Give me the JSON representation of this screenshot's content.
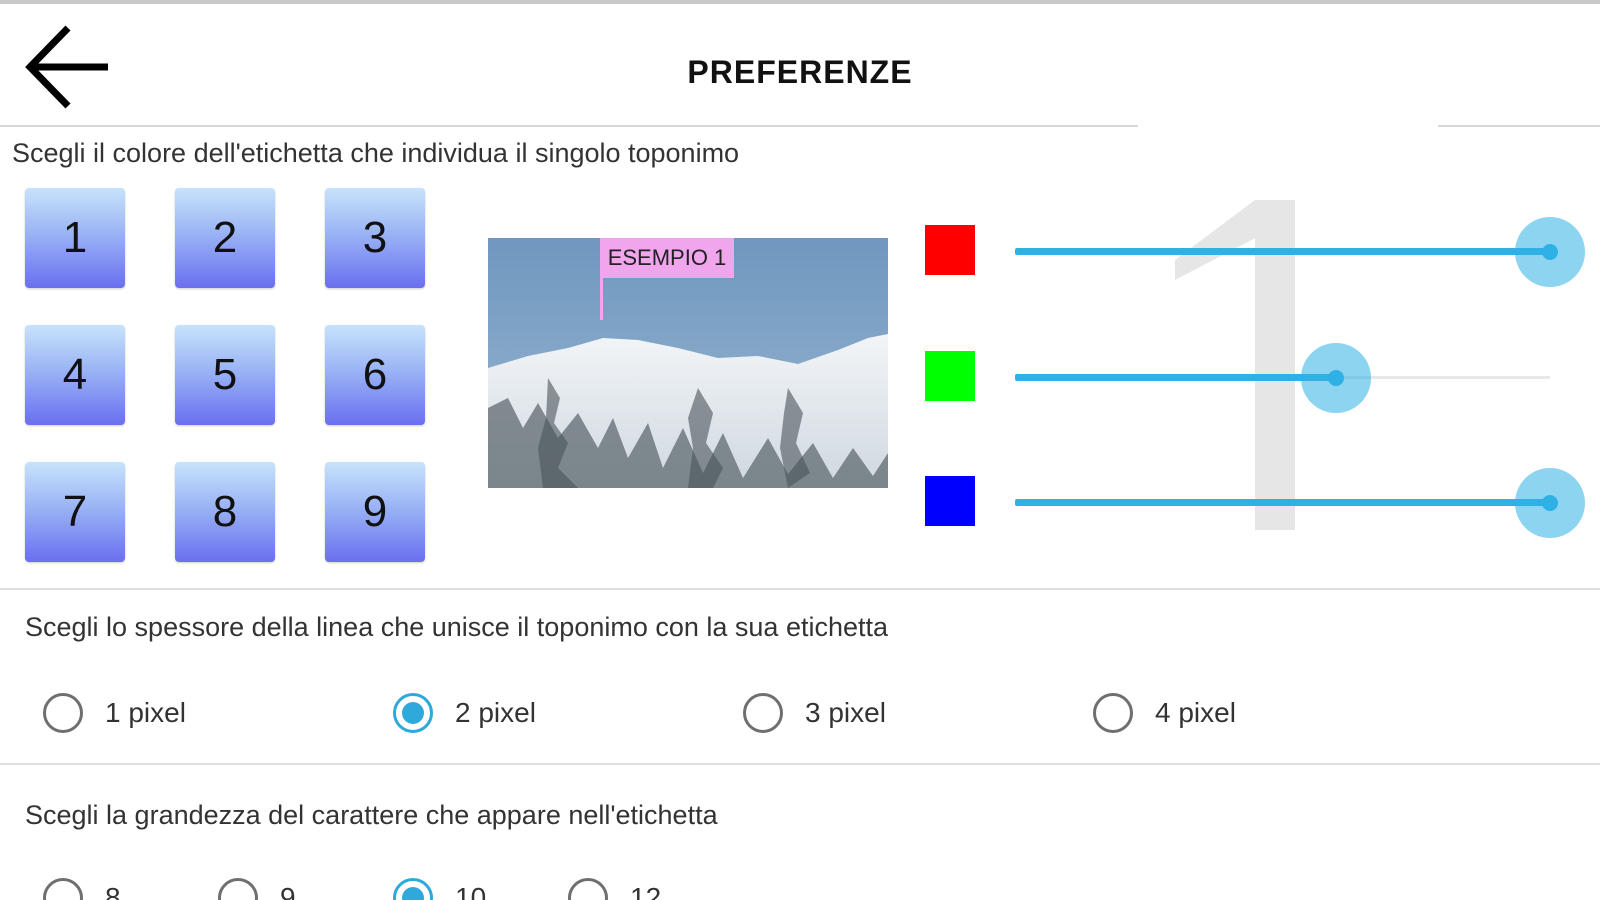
{
  "header": {
    "title": "PREFERENZE",
    "back_icon": "arrow-left-icon"
  },
  "color_section": {
    "label": "Scegli il colore dell'etichetta che individua il singolo toponimo",
    "number_buttons": [
      "1",
      "2",
      "3",
      "4",
      "5",
      "6",
      "7",
      "8",
      "9"
    ],
    "example": {
      "label": "ESEMPIO 1",
      "label_color": "#f0a6ec"
    },
    "watermark": "1",
    "channels": [
      {
        "name": "red",
        "swatch_color": "#ff0000",
        "value_fraction": 1.0
      },
      {
        "name": "green",
        "swatch_color": "#00ff00",
        "value_fraction": 0.6
      },
      {
        "name": "blue",
        "swatch_color": "#0000ff",
        "value_fraction": 1.0
      }
    ],
    "accent_color": "#2fb1e6"
  },
  "line_section": {
    "label": "Scegli lo spessore della linea che unisce il toponimo con la sua etichetta",
    "options": [
      "1 pixel",
      "2 pixel",
      "3 pixel",
      "4 pixel"
    ],
    "selected": "2 pixel"
  },
  "font_section": {
    "label": "Scegli la grandezza del carattere che appare nell'etichetta",
    "options": [
      "8",
      "9",
      "10",
      "12"
    ],
    "selected": "10"
  }
}
